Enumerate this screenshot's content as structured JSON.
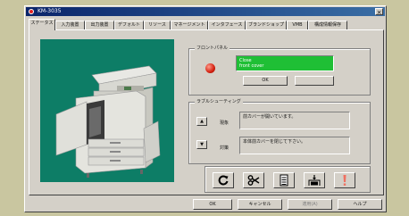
{
  "window": {
    "title": "KM-3035",
    "close_glyph": "×"
  },
  "tabs": [
    "ステータス",
    "入力装置",
    "出力装置",
    "デフォルト",
    "リソース",
    "マネージメント",
    "インタフェース",
    "ブランドショップ",
    "VMB",
    "構成情報保存"
  ],
  "front_panel": {
    "label": "フロントパネル",
    "display_lines": [
      "Close",
      "front cover"
    ],
    "ok_label": "OK",
    "secondary_label": "",
    "lamp_color": "#d32010",
    "display_color": "#1fbf35"
  },
  "trouble_shooting": {
    "label": "ラブルシューティング",
    "state_label": "現象",
    "state_text": "前カバーが開いています。",
    "action_label": "対策",
    "action_text": "本体前カバーを閉じて下さい。",
    "up_glyph": "▲",
    "down_glyph": "▼"
  },
  "icons": [
    "refresh-icon",
    "scissors-icon",
    "paper-tray-icon",
    "toner-icon",
    "exclamation-icon"
  ],
  "footer": {
    "ok": "OK",
    "cancel": "キャンセル",
    "apply": "適用(A)",
    "help": "ヘルプ"
  }
}
